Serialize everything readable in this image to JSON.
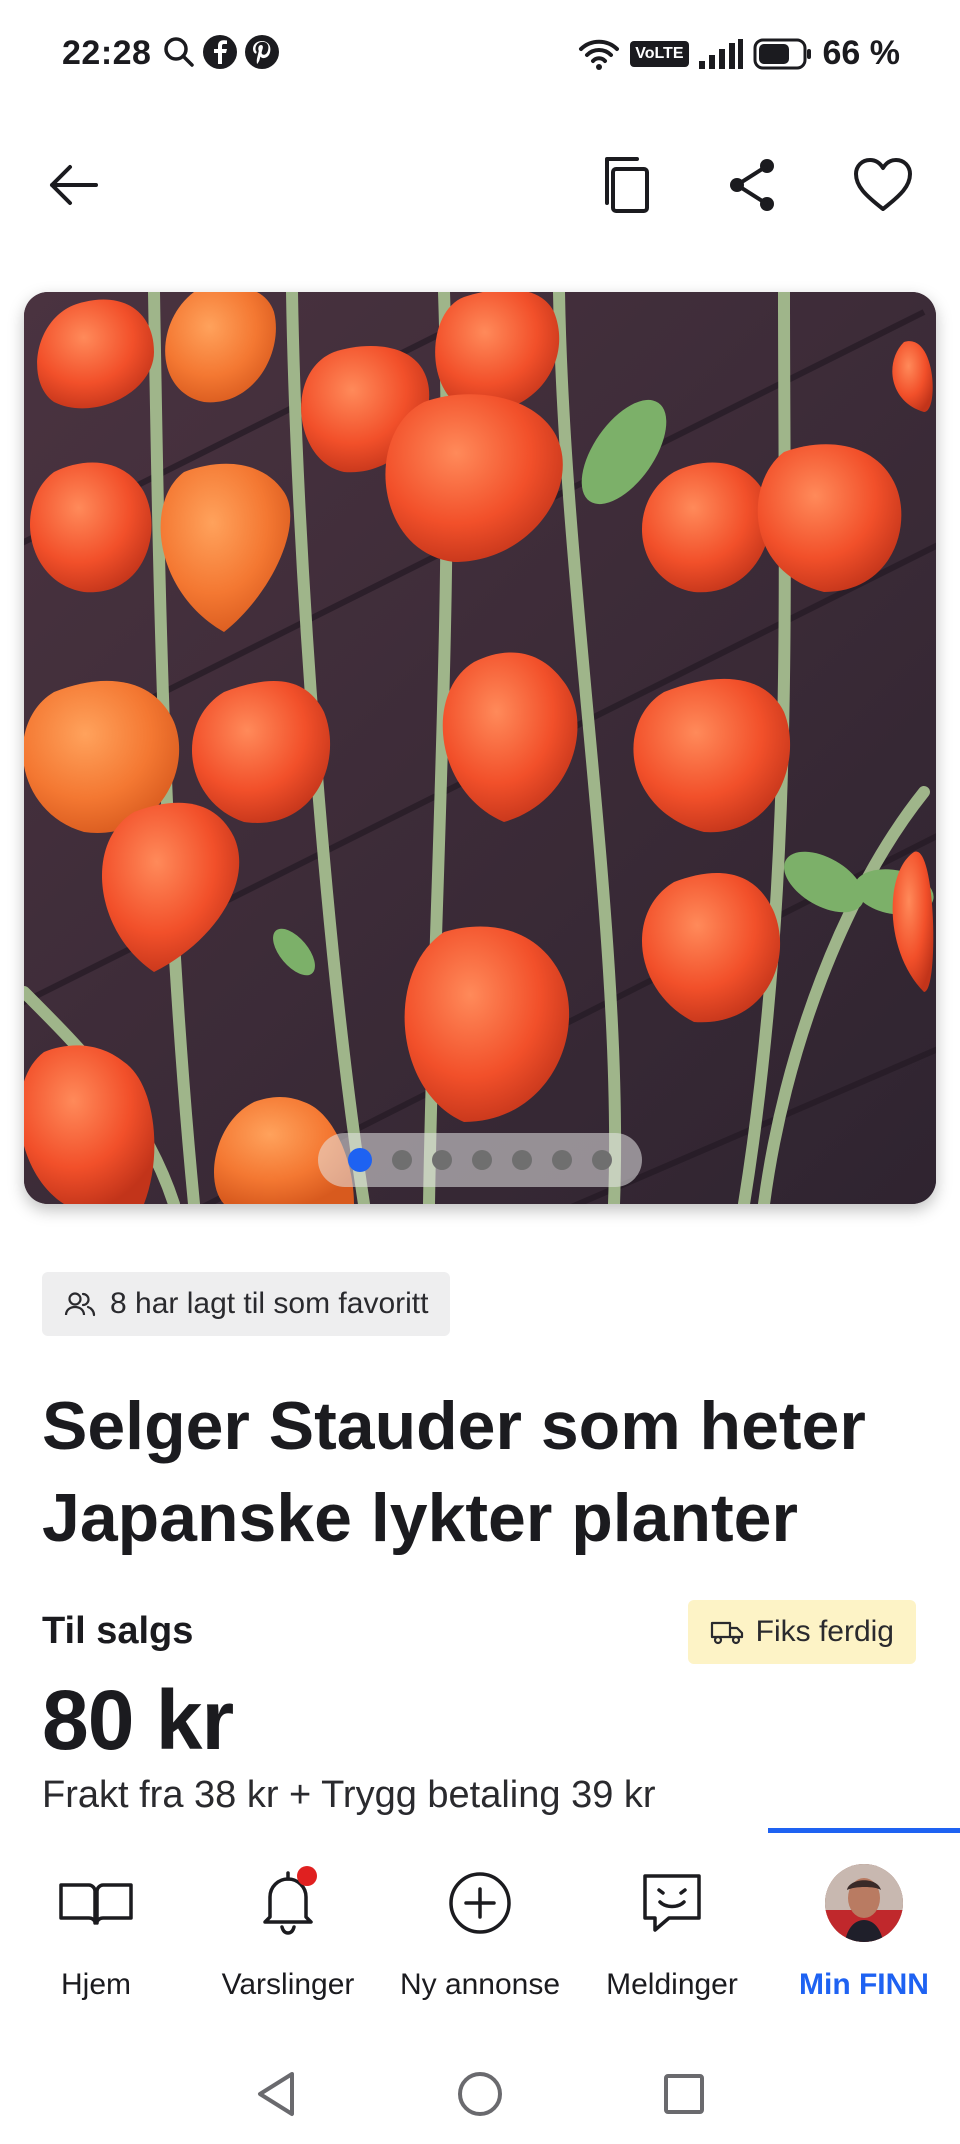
{
  "status_bar": {
    "time": "22:28",
    "left_icons": [
      "search-icon",
      "facebook-icon",
      "pinterest-icon"
    ],
    "volte": "VoLTE",
    "battery_percent": "66 %"
  },
  "top_nav": {
    "icons": [
      "back-arrow-icon",
      "copy-icon",
      "share-icon",
      "heart-icon"
    ]
  },
  "carousel": {
    "image_count": 7,
    "active_index": 0
  },
  "listing": {
    "favorites_text": "8 har lagt til som favoritt",
    "title": "Selger Stauder som heter Japanske lykter planter",
    "sale_type": "Til salgs",
    "shipping_badge": "Fiks ferdig",
    "price": "80 kr",
    "shipping_text": "Frakt fra 38 kr + Trygg betaling 39 kr"
  },
  "tab_bar": {
    "tabs": [
      {
        "label": "Hjem",
        "icon": "book-icon"
      },
      {
        "label": "Varslinger",
        "icon": "bell-icon"
      },
      {
        "label": "Ny annonse",
        "icon": "plus-circle-icon"
      },
      {
        "label": "Meldinger",
        "icon": "chat-icon"
      },
      {
        "label": "Min FINN",
        "icon": "avatar"
      }
    ],
    "active_tab": "Min FINN",
    "accent_color": "#1e62f2"
  },
  "colors": {
    "fav_badge_bg": "#eeeeef",
    "fiks_badge_bg": "#fdf3c6",
    "notification_dot": "#e02020"
  }
}
